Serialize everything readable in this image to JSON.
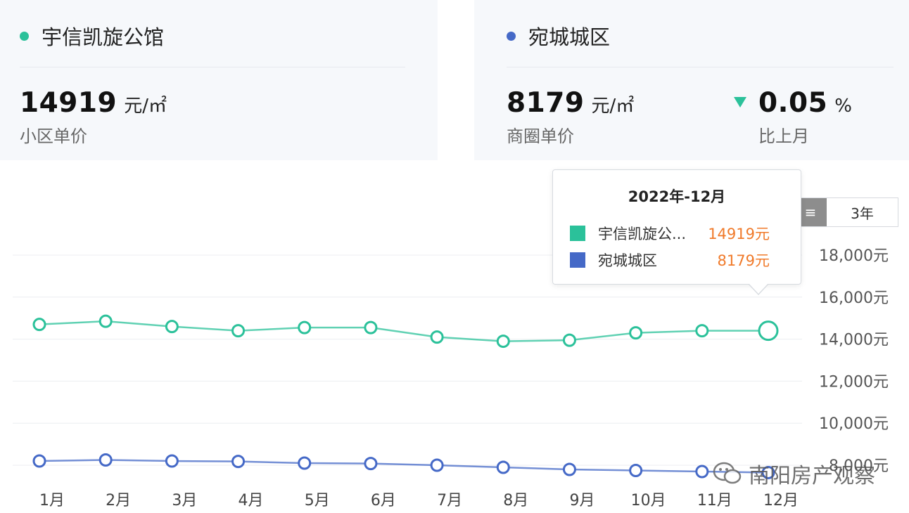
{
  "left_card": {
    "name": "宇信凯旋公馆",
    "dot_color": "#2bc19a",
    "price": "14919",
    "unit": "元/㎡",
    "label": "小区单价"
  },
  "right_card": {
    "name": "宛城城区",
    "dot_color": "#4569c7",
    "price": "8179",
    "unit": "元/㎡",
    "label": "商圈单价",
    "change_value": "0.05",
    "change_unit": "%",
    "change_label": "比上月",
    "change_direction": "down",
    "change_color": "#2bc19a"
  },
  "period_buttons": {
    "active_label": "",
    "other_label": "3年"
  },
  "tooltip": {
    "title": "2022年-12月",
    "rows": [
      {
        "name": "宇信凯旋公...",
        "value": "14919元",
        "color": "#2bc19a"
      },
      {
        "name": "宛城城区",
        "value": "8179元",
        "color": "#4569c7"
      }
    ]
  },
  "watermark": {
    "text": "南阳房产观察"
  },
  "chart_data": {
    "type": "line",
    "categories": [
      "1月",
      "2月",
      "3月",
      "4月",
      "5月",
      "6月",
      "7月",
      "8月",
      "9月",
      "10月",
      "11月",
      "12月"
    ],
    "y_ticks": [
      8000,
      10000,
      12000,
      14000,
      16000,
      18000
    ],
    "y_tick_labels": [
      "8,000元",
      "10,000元",
      "12,000元",
      "14,000元",
      "16,000元",
      "18,000元"
    ],
    "ylim": [
      7800,
      18400
    ],
    "y_axis_position": "right",
    "grid": true,
    "highlighted_index": 11,
    "series": [
      {
        "name": "宇信凯旋公馆",
        "color": "#2bc19a",
        "values": [
          14700,
          14850,
          14600,
          14400,
          14550,
          14550,
          14100,
          13900,
          13950,
          14300,
          14400,
          14400
        ]
      },
      {
        "name": "宛城城区",
        "color": "#4569c7",
        "values": [
          8200,
          8250,
          8200,
          8180,
          8100,
          8080,
          8000,
          7900,
          7800,
          7750,
          7700,
          7650
        ]
      }
    ]
  }
}
